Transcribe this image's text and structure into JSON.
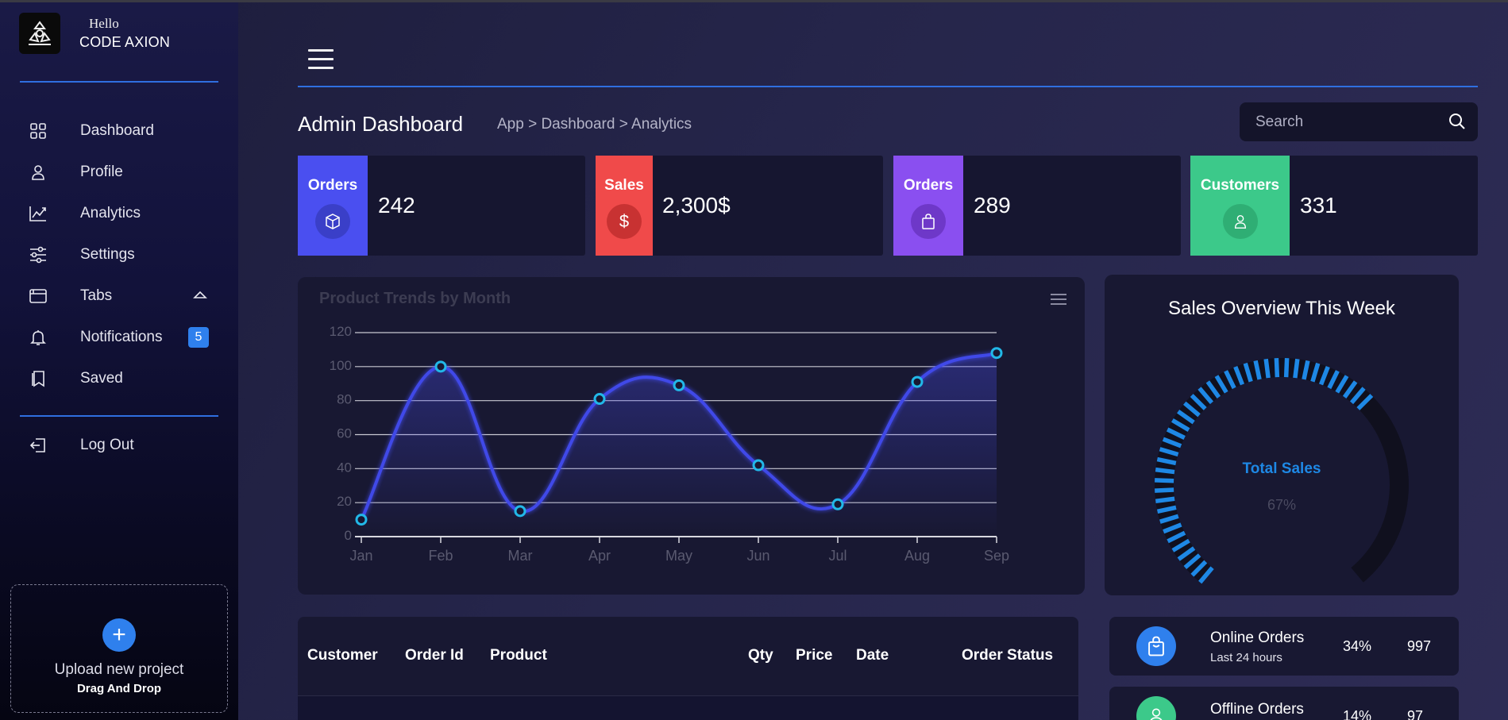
{
  "brand": {
    "hello": "Hello",
    "name": "CODE AXION"
  },
  "nav": [
    {
      "label": "Dashboard",
      "icon": "grid-icon"
    },
    {
      "label": "Profile",
      "icon": "user-icon"
    },
    {
      "label": "Analytics",
      "icon": "trend-icon"
    },
    {
      "label": "Settings",
      "icon": "sliders-icon"
    },
    {
      "label": "Tabs",
      "icon": "tabs-icon"
    },
    {
      "label": "Notifications",
      "icon": "bell-icon",
      "badge": "5"
    },
    {
      "label": "Saved",
      "icon": "bookmark-icon"
    }
  ],
  "logout": {
    "label": "Log Out",
    "icon": "logout-icon"
  },
  "upload": {
    "title": "Upload new project",
    "subtitle": "Drag And Drop"
  },
  "header": {
    "title": "Admin Dashboard",
    "breadcrumb": "App > Dashboard > Analytics",
    "search_placeholder": "Search"
  },
  "cards": [
    {
      "label": "Orders",
      "value": "242",
      "color": "#4a4ff0",
      "icon": "box-icon"
    },
    {
      "label": "Sales",
      "value": "2,300$",
      "color": "#f04a4a",
      "icon": "dollar-icon"
    },
    {
      "label": "Orders",
      "value": "289",
      "color": "#8a4ff0",
      "icon": "bag-icon"
    },
    {
      "label": "Customers",
      "value": "331",
      "color": "#3cc98a",
      "icon": "user-icon"
    }
  ],
  "chart_data": {
    "type": "line",
    "title": "Product Trends by Month",
    "categories": [
      "Jan",
      "Feb",
      "Mar",
      "Apr",
      "May",
      "Jun",
      "Jul",
      "Aug",
      "Sep"
    ],
    "values": [
      10,
      100,
      15,
      81,
      89,
      42,
      19,
      91,
      108
    ],
    "ylim": [
      0,
      120
    ],
    "yticks": [
      0,
      20,
      40,
      60,
      80,
      100,
      120
    ],
    "grid": true,
    "color": "#4048e8"
  },
  "gauge": {
    "title": "Sales Overview This Week",
    "label": "Total Sales",
    "value_text": "67%",
    "value": 0.67,
    "color": "#1e88e5"
  },
  "table": {
    "headers": [
      "Customer",
      "Order Id",
      "Product",
      "Qty",
      "Price",
      "Date",
      "Order Status"
    ]
  },
  "stats": [
    {
      "name": "Online Orders",
      "sub": "Last 24 hours",
      "pct": "34%",
      "count": "997",
      "color": "#2f80ed",
      "icon": "bag-icon"
    },
    {
      "name": "Offline Orders",
      "sub": "",
      "pct": "14%",
      "count": "97",
      "color": "#3cc98a",
      "icon": "user-icon"
    }
  ]
}
